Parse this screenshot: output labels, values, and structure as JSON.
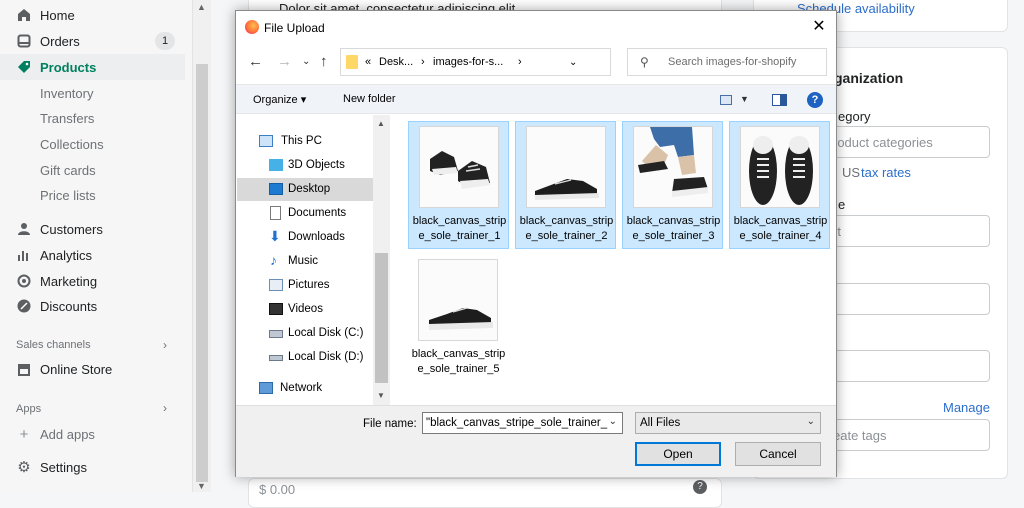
{
  "sidebar": {
    "items": [
      {
        "label": "Home",
        "icon": "home-icon"
      },
      {
        "label": "Orders",
        "icon": "orders-icon",
        "badge": "1"
      },
      {
        "label": "Products",
        "icon": "products-tag-icon",
        "active": true
      },
      {
        "label": "Inventory",
        "sub": true
      },
      {
        "label": "Transfers",
        "sub": true
      },
      {
        "label": "Collections",
        "sub": true
      },
      {
        "label": "Gift cards",
        "sub": true
      },
      {
        "label": "Price lists",
        "sub": true
      },
      {
        "label": "Customers",
        "icon": "customers-icon"
      },
      {
        "label": "Analytics",
        "icon": "analytics-icon"
      },
      {
        "label": "Marketing",
        "icon": "marketing-icon"
      },
      {
        "label": "Discounts",
        "icon": "discounts-icon"
      }
    ],
    "sales_channels_heading": "Sales channels",
    "online_store": "Online Store",
    "apps_heading": "Apps",
    "add_apps": "Add apps",
    "settings": "Settings"
  },
  "main": {
    "bullet_text": "Dolor sit amet, consectetur adipiscing elit",
    "schedule_availability": "Schedule availability",
    "organization_heading": "ganization",
    "category_label": "egory",
    "category_placeholder": "roduct categories",
    "us_prefix": "US",
    "tax_rates": "tax rates",
    "type_label": "e",
    "type_placeholder": "rt",
    "manage": "Manage",
    "tags_placeholder": "eate tags",
    "price_value": "$ 0.00"
  },
  "dialog": {
    "title": "File Upload",
    "close_glyph": "✕",
    "path": [
      "«",
      "Desk...",
      "›",
      "images-for-s...",
      "›"
    ],
    "search_placeholder": "Search images-for-shopify",
    "organize": "Organize ▾",
    "new_folder": "New folder",
    "tree": [
      {
        "label": "This PC",
        "icon": "pc-icon"
      },
      {
        "label": "3D Objects",
        "icon": "3d-objects-icon"
      },
      {
        "label": "Desktop",
        "icon": "desktop-icon",
        "selected": true
      },
      {
        "label": "Documents",
        "icon": "documents-icon"
      },
      {
        "label": "Downloads",
        "icon": "downloads-icon"
      },
      {
        "label": "Music",
        "icon": "music-icon"
      },
      {
        "label": "Pictures",
        "icon": "pictures-icon"
      },
      {
        "label": "Videos",
        "icon": "videos-icon"
      },
      {
        "label": "Local Disk (C:)",
        "icon": "disk-c-icon"
      },
      {
        "label": "Local Disk (D:)",
        "icon": "disk-d-icon"
      },
      {
        "label": "Network",
        "icon": "network-icon"
      }
    ],
    "files": [
      {
        "name": "black_canvas_stripe_sole_trainer_1",
        "selected": true
      },
      {
        "name": "black_canvas_stripe_sole_trainer_2",
        "selected": true
      },
      {
        "name": "black_canvas_stripe_sole_trainer_3",
        "selected": true
      },
      {
        "name": "black_canvas_stripe_sole_trainer_4",
        "selected": true
      },
      {
        "name": "black_canvas_stripe_sole_trainer_5",
        "selected": false
      }
    ],
    "file_name_label": "File name:",
    "file_name_value": "\"black_canvas_stripe_sole_trainer_",
    "file_type": "All Files",
    "open": "Open",
    "cancel": "Cancel"
  }
}
